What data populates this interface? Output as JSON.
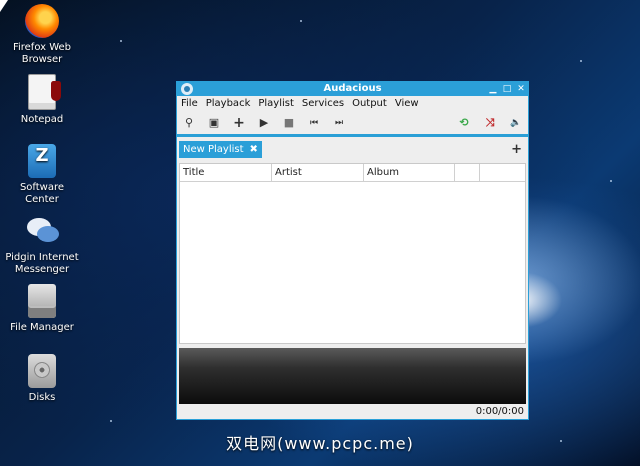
{
  "desktop": {
    "icons": [
      {
        "label_line1": "Firefox Web",
        "label_line2": "Browser",
        "icon": "firefox-icon"
      },
      {
        "label_line1": "Notepad",
        "label_line2": "",
        "icon": "notepad-icon"
      },
      {
        "label_line1": "Software",
        "label_line2": "Center",
        "icon": "software-center-icon"
      },
      {
        "label_line1": "Pidgin Internet",
        "label_line2": "Messenger",
        "icon": "pidgin-icon"
      },
      {
        "label_line1": "File Manager",
        "label_line2": "",
        "icon": "file-manager-icon"
      },
      {
        "label_line1": "Disks",
        "label_line2": "",
        "icon": "disks-icon"
      }
    ]
  },
  "window": {
    "title": "Audacious",
    "accent": "#2b9fd8",
    "controls": {
      "minimize": "▁",
      "maximize": "□",
      "close": "✕"
    }
  },
  "menu": [
    "File",
    "Playback",
    "Playlist",
    "Services",
    "Output",
    "View"
  ],
  "toolbar": {
    "search": "⚲",
    "open": "▣",
    "add": "+",
    "play": "▶",
    "stop": "■",
    "previous": "⏮",
    "next": "⏭",
    "repeat": "⟲",
    "shuffle": "⤨",
    "volume": "🔈"
  },
  "playlist": {
    "tab_label": "New Playlist",
    "tab_close": "✖",
    "add_tab": "+",
    "columns": [
      "Title",
      "Artist",
      "Album",
      ""
    ]
  },
  "status": {
    "time": "0:00/0:00"
  },
  "watermark": "双电网(www.pcpc.me)"
}
